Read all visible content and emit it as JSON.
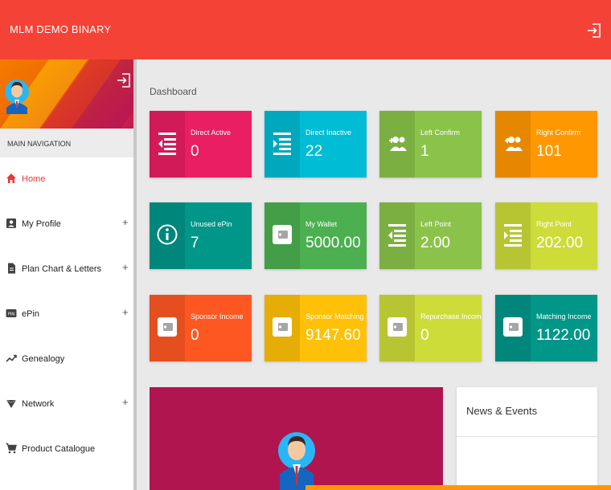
{
  "app": {
    "title": "MLM DEMO BINARY"
  },
  "sidebar": {
    "nav_header": "MAIN NAVIGATION",
    "items": [
      {
        "label": "Home",
        "icon": "home-icon",
        "expandable": false,
        "active": true
      },
      {
        "label": "My Profile",
        "icon": "profile-icon",
        "expandable": true,
        "active": false
      },
      {
        "label": "Plan Chart & Letters",
        "icon": "document-icon",
        "expandable": true,
        "active": false
      },
      {
        "label": "ePin",
        "icon": "pin-icon",
        "expandable": true,
        "active": false
      },
      {
        "label": "Genealogy",
        "icon": "trending-icon",
        "expandable": false,
        "active": false
      },
      {
        "label": "Network",
        "icon": "network-icon",
        "expandable": true,
        "active": false
      },
      {
        "label": "Product Catalogue",
        "icon": "cart-icon",
        "expandable": false,
        "active": false
      }
    ],
    "expand_symbol": "+"
  },
  "dashboard": {
    "title": "Dashboard",
    "cards": [
      {
        "label": "Direct Active",
        "value": "0",
        "color": "#e91e63",
        "icon": "list-left-icon"
      },
      {
        "label": "Direct Inactive",
        "value": "22",
        "color": "#00bcd4",
        "icon": "list-right-icon"
      },
      {
        "label": "Left Confirm",
        "value": "1",
        "color": "#8bc34a",
        "icon": "add-user-icon"
      },
      {
        "label": "Right Confirm",
        "value": "101",
        "color": "#ff9800",
        "icon": "add-user-icon"
      },
      {
        "label": "Unused ePin",
        "value": "7",
        "color": "#009688",
        "icon": "info-icon"
      },
      {
        "label": "My Wallet",
        "value": "5000.00",
        "color": "#4caf50",
        "icon": "wallet-icon"
      },
      {
        "label": "Left Point",
        "value": "2.00",
        "color": "#8bc34a",
        "icon": "list-left-icon"
      },
      {
        "label": "Right Point",
        "value": "202.00",
        "color": "#cddc39",
        "icon": "list-right-icon"
      },
      {
        "label": "Sponsor Income",
        "value": "0",
        "color": "#ff5722",
        "icon": "wallet-icon"
      },
      {
        "label": "Sponsor Matching",
        "value": "9147.60",
        "color": "#ffc107",
        "icon": "wallet-icon"
      },
      {
        "label": "Repurchase Income",
        "value": "0",
        "color": "#cddc39",
        "icon": "wallet-icon"
      },
      {
        "label": "Matching Income",
        "value": "1122.00",
        "color": "#009688",
        "icon": "wallet-icon"
      }
    ]
  },
  "news": {
    "title": "News & Events"
  },
  "colors": {
    "header": "#f44336",
    "profile_panel": "#b0154f",
    "accent_bar": "#ff9800"
  }
}
